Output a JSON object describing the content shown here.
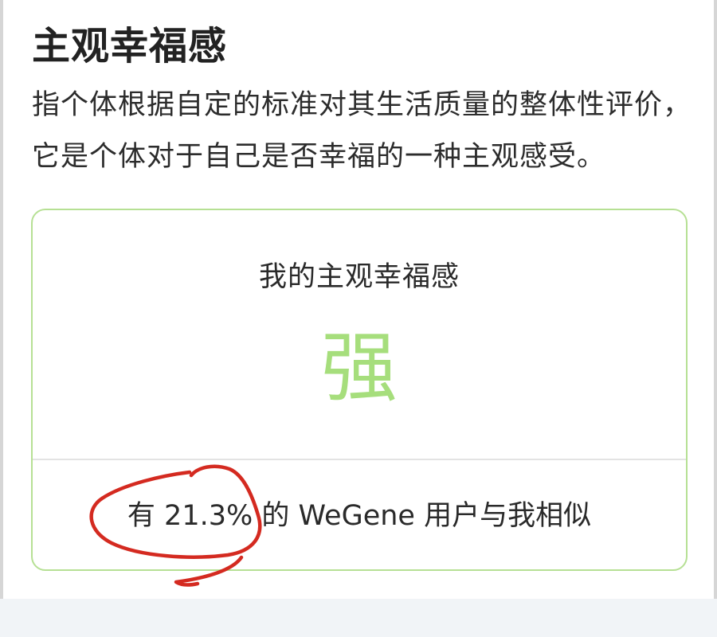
{
  "section": {
    "title": "主观幸福感",
    "description": "指个体根据自定的标准对其生活质量的整体性评价，它是个体对于自己是否幸福的一种主观感受。"
  },
  "card": {
    "title": "我的主观幸福感",
    "level": "强",
    "similarity_prefix": "有 ",
    "similarity_value": "21.3%",
    "similarity_suffix": " 的 WeGene 用户与我相似"
  },
  "colors": {
    "accent_green": "#a6de7c",
    "card_border": "#b6e094",
    "annotation_red": "#d42a20"
  }
}
